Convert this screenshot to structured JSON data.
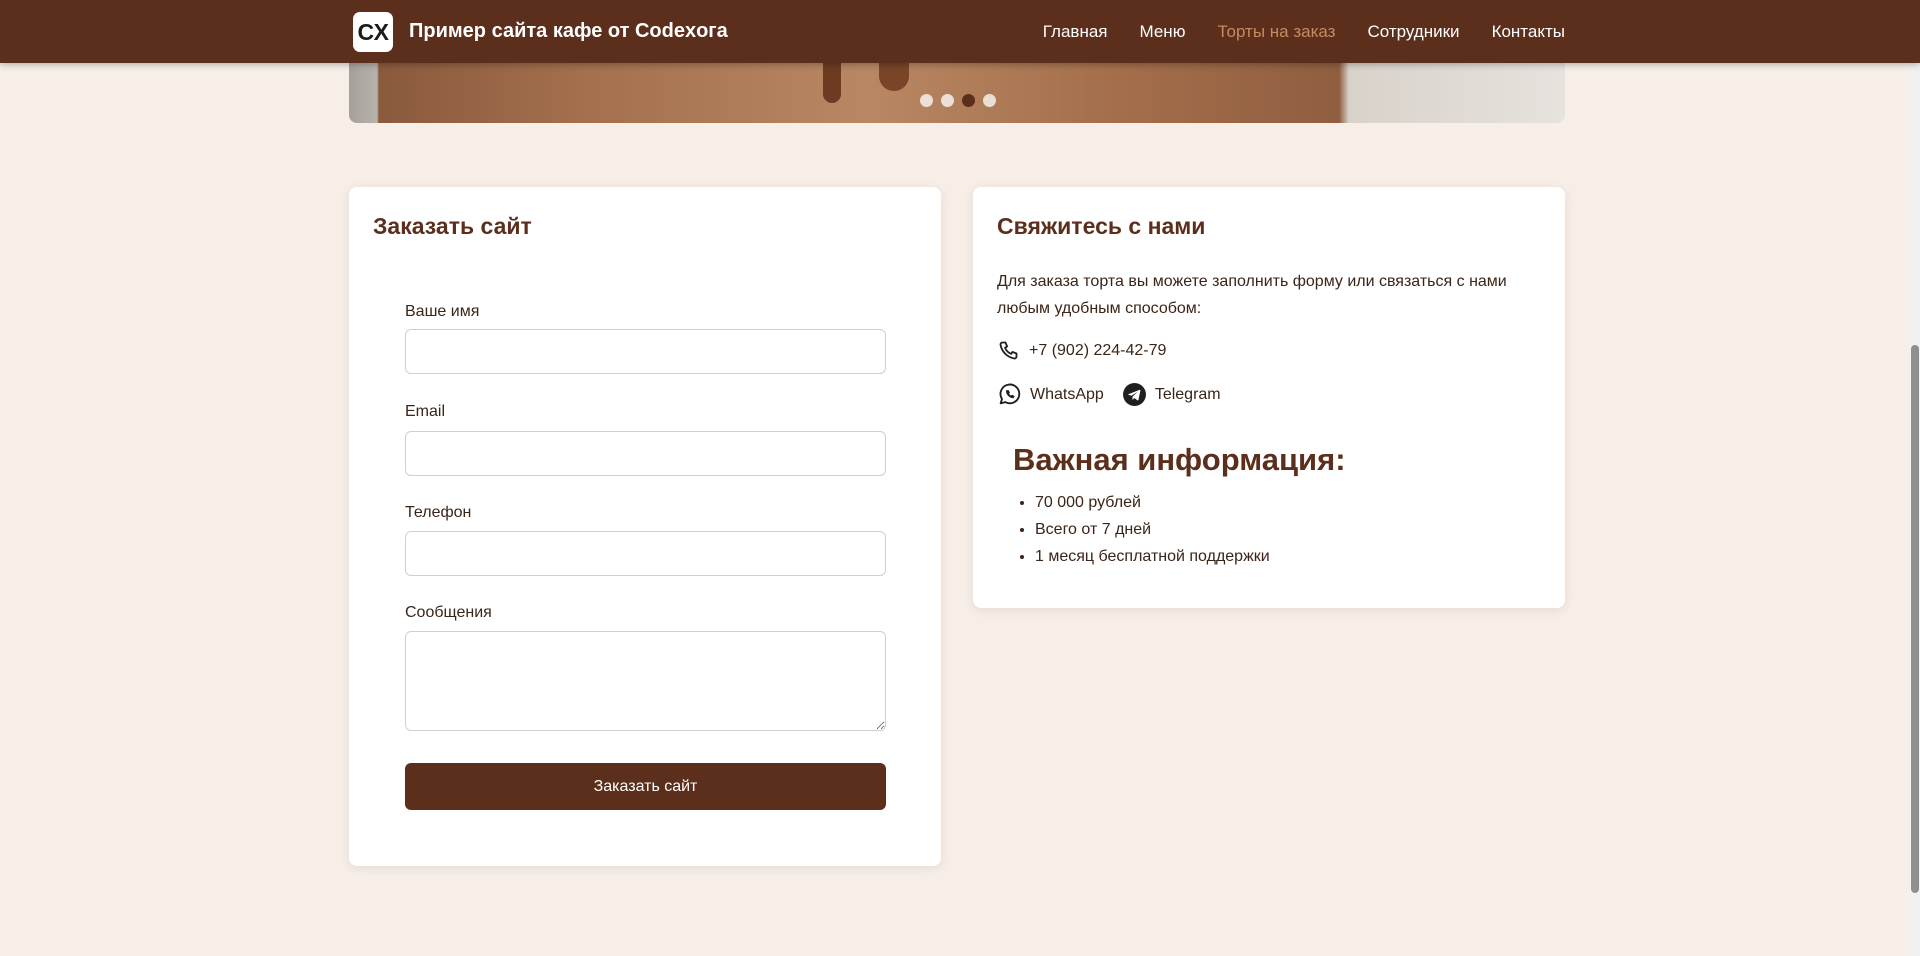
{
  "header": {
    "logo_text": "CX",
    "site_title": "Пример сайта кафе от Codexога",
    "nav": [
      {
        "label": "Главная",
        "active": false
      },
      {
        "label": "Меню",
        "active": false
      },
      {
        "label": "Торты на заказ",
        "active": true
      },
      {
        "label": "Сотрудники",
        "active": false
      },
      {
        "label": "Контакты",
        "active": false
      }
    ]
  },
  "slider": {
    "dot_count": 4,
    "active_dot": 3
  },
  "order_form": {
    "title": "Заказать сайт",
    "fields": [
      {
        "label": "Ваше имя",
        "value": "",
        "placeholder": ""
      },
      {
        "label": "Email",
        "value": "",
        "placeholder": ""
      },
      {
        "label": "Телефон",
        "value": "",
        "placeholder": ""
      },
      {
        "label": "Сообщения",
        "value": "",
        "placeholder": ""
      }
    ],
    "submit_label": "Заказать сайт"
  },
  "contacts": {
    "title": "Свяжитесь с нами",
    "intro": "Для заказа торта вы можете заполнить форму или связаться с нами любым удобным способом:",
    "phone": "+7 (902) 224-42-79",
    "whatsapp": "WhatsApp",
    "telegram": "Telegram",
    "info_title": "Важная информация:",
    "info_items": [
      "70 000 рублей",
      "Всего от 7 дней",
      "1 месяц бесплатной поддержки"
    ]
  },
  "colors": {
    "brand": "#5c2e1c",
    "active_nav": "#c58b63",
    "page_bg": "#f6eee7"
  },
  "icons": {
    "phone": "phone-icon",
    "whatsapp": "whatsapp-icon",
    "telegram": "telegram-icon"
  }
}
